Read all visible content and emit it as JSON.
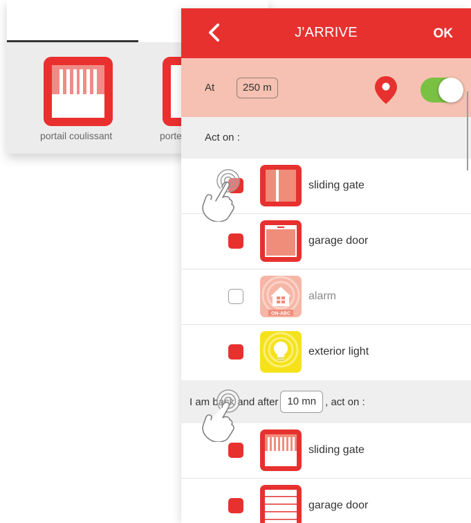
{
  "background_screen": {
    "tiles": [
      {
        "label": "portail coulissant"
      },
      {
        "label": "porte"
      }
    ]
  },
  "header": {
    "title": "J'ARRIVE",
    "ok_label": "OK",
    "back_icon": "chevron-left-icon"
  },
  "distance": {
    "label": "At",
    "value": "250 m",
    "toggle_on": true
  },
  "section1": {
    "title": "Act on :",
    "items": [
      {
        "label": "sliding gate",
        "checked": true,
        "icon": "sliding-gate-icon"
      },
      {
        "label": "garage door",
        "checked": true,
        "icon": "garage-door-icon"
      },
      {
        "label": "alarm",
        "checked": false,
        "icon": "alarm-icon",
        "badge": "ON-ABC"
      },
      {
        "label": "exterior light",
        "checked": true,
        "icon": "light-bulb-icon"
      }
    ]
  },
  "section2": {
    "prefix": "I am back and after",
    "delay": "10 mn",
    "suffix": ", act on :",
    "items": [
      {
        "label": "sliding gate",
        "checked": true,
        "icon": "sliding-gate-icon"
      },
      {
        "label": "garage door",
        "checked": true,
        "icon": "garage-door-icon"
      }
    ]
  },
  "colors": {
    "accent": "#e7312f",
    "distance_bar": "#f6c1b2",
    "toggle_on": "#7ac143",
    "section_bg": "#efefef"
  }
}
